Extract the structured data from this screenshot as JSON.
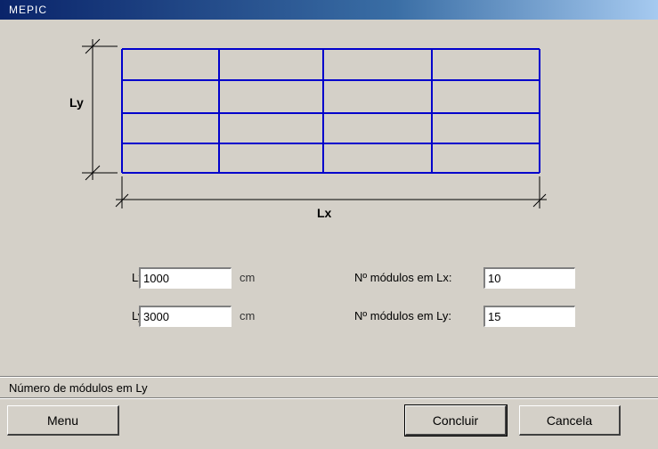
{
  "window": {
    "title": "MEPIC"
  },
  "diagram": {
    "ly_label": "Ly",
    "lx_label": "Lx",
    "grid_columns": 4,
    "grid_rows": 4,
    "line_color": "#0000cc"
  },
  "form": {
    "lx_label": "Lx:",
    "lx_value": "1000",
    "lx_unit": "cm",
    "ly_label": "Ly:",
    "ly_value": "3000",
    "ly_unit": "cm",
    "nlx_label": "Nº módulos em Lx:",
    "nlx_value": "10",
    "nly_label": "Nº módulos em Ly:",
    "nly_value": "15"
  },
  "status": {
    "text": "Número de módulos em Ly"
  },
  "buttons": {
    "menu": "Menu",
    "concluir": "Concluir",
    "cancela": "Cancela"
  }
}
